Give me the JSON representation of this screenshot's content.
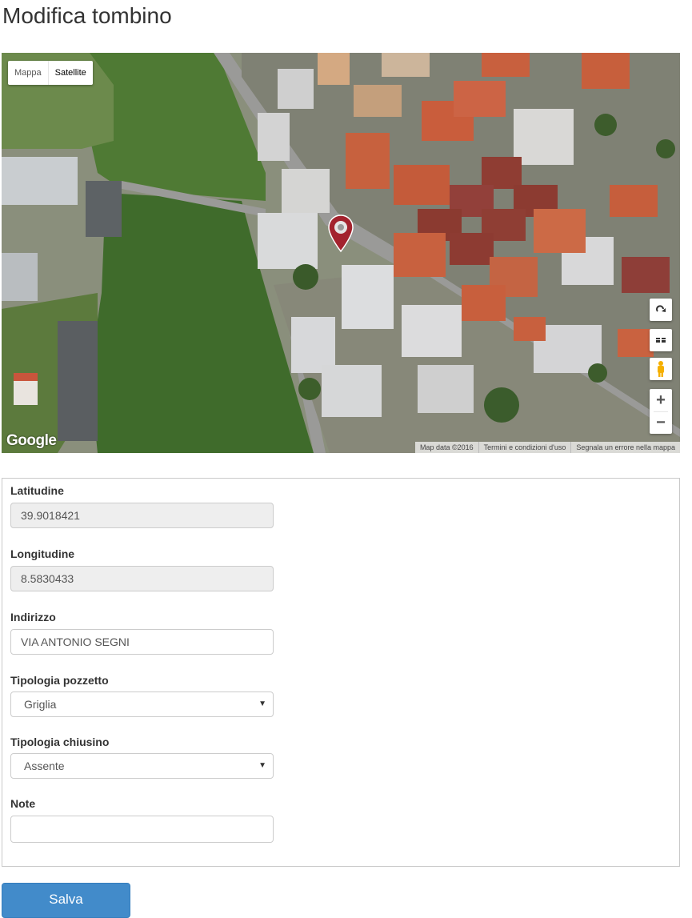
{
  "page": {
    "title": "Modifica tombino"
  },
  "map": {
    "map_type_options": [
      "Mappa",
      "Satellite"
    ],
    "selected_map_type": "Satellite",
    "logo": "Google",
    "attribution": [
      "Map data ©2016",
      "Termini e condizioni d'uso",
      "Segnala un errore nella mappa"
    ],
    "controls": {
      "zoom_in": "+",
      "zoom_out": "−"
    },
    "icons": [
      "rotate-icon",
      "tilt-icon",
      "pegman-icon",
      "location-marker-icon"
    ],
    "marker_color": "#a3232e"
  },
  "form": {
    "latitude": {
      "label": "Latitudine",
      "value": "39.9018421"
    },
    "longitude": {
      "label": "Longitudine",
      "value": "8.5830433"
    },
    "address": {
      "label": "Indirizzo",
      "value": "VIA ANTONIO SEGNI"
    },
    "manhole_type": {
      "label": "Tipologia pozzetto",
      "selected": "Griglia"
    },
    "cover_type": {
      "label": "Tipologia chiusino",
      "selected": "Assente"
    },
    "notes": {
      "label": "Note",
      "value": ""
    }
  },
  "actions": {
    "save_label": "Salva"
  },
  "colors": {
    "primary_button": "#428bca",
    "readonly_field": "#eeeeee"
  }
}
